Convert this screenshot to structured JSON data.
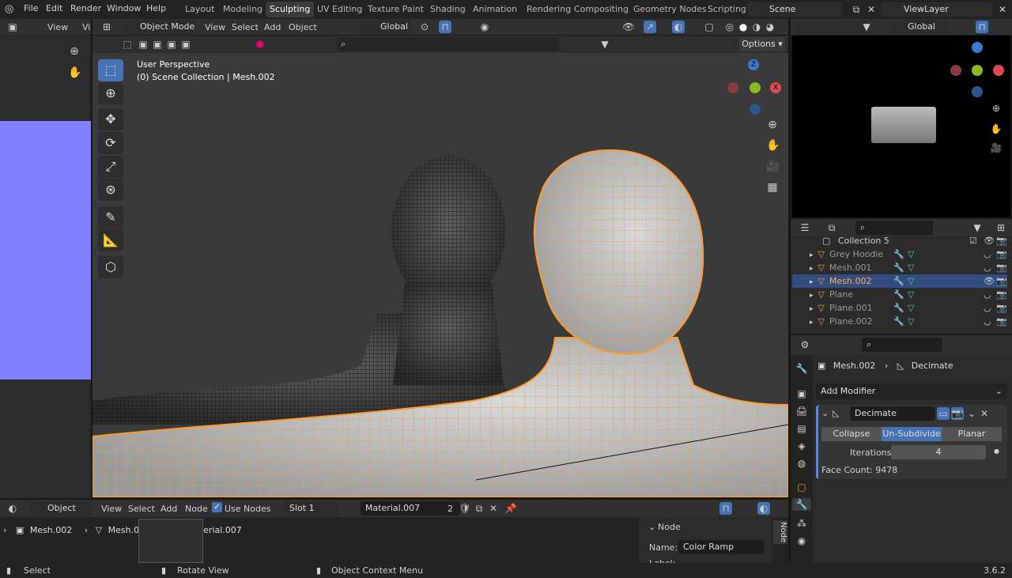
{
  "menu": {
    "file": "File",
    "edit": "Edit",
    "render": "Render",
    "window": "Window",
    "help": "Help"
  },
  "workspaces": [
    "Layout",
    "Modeling",
    "Sculpting",
    "UV Editing",
    "Texture Paint",
    "Shading",
    "Animation",
    "Rendering",
    "Compositing",
    "Geometry Nodes",
    "Scripting"
  ],
  "active_workspace": "Sculpting",
  "scene": {
    "name": "Scene",
    "view_layer": "ViewLayer"
  },
  "left_panel": {
    "view": "View",
    "vi": "Vi"
  },
  "viewport_header": {
    "mode": "Object Mode",
    "view": "View",
    "select": "Select",
    "add": "Add",
    "object": "Object",
    "orientation": "Global",
    "options": "Options"
  },
  "viewport": {
    "title": "User Perspective",
    "subtitle": "(0) Scene Collection | Mesh.002"
  },
  "gizmo": {
    "z": "Z",
    "x": "X"
  },
  "right_header": {
    "orientation": "Global"
  },
  "outliner": {
    "collection": "Collection 5",
    "items": [
      {
        "name": "Grey Hoodie",
        "selected": false
      },
      {
        "name": "Mesh.001",
        "selected": false
      },
      {
        "name": "Mesh.002",
        "selected": true
      },
      {
        "name": "Plane",
        "selected": false
      },
      {
        "name": "Plane.001",
        "selected": false
      },
      {
        "name": "Plane.002",
        "selected": false
      }
    ]
  },
  "properties": {
    "object": "Mesh.002",
    "modifier_crumb": "Decimate",
    "add_modifier": "Add Modifier",
    "modifier_name": "Decimate",
    "modes": [
      "Collapse",
      "Un-Subdivide",
      "Planar"
    ],
    "active_mode": "Un-Subdivide",
    "iterations_label": "Iterations",
    "iterations_value": "4",
    "face_count": "Face Count: 9478"
  },
  "node_header": {
    "object": "Object",
    "view": "View",
    "select": "Select",
    "add": "Add",
    "node": "Node",
    "use_nodes": "Use Nodes",
    "slot": "Slot 1",
    "material": "Material.007",
    "users": "2"
  },
  "node_crumbs": {
    "a": "Mesh.002",
    "b": "Mesh.005",
    "c": "Material.007"
  },
  "node_panel": {
    "title": "Node",
    "name_label": "Name:",
    "name_value": "Color Ramp",
    "label_label": "Label:",
    "tab": "Node"
  },
  "status": {
    "select": "Select",
    "rotate": "Rotate View",
    "context": "Object Context Menu",
    "version": "3.6.2"
  }
}
